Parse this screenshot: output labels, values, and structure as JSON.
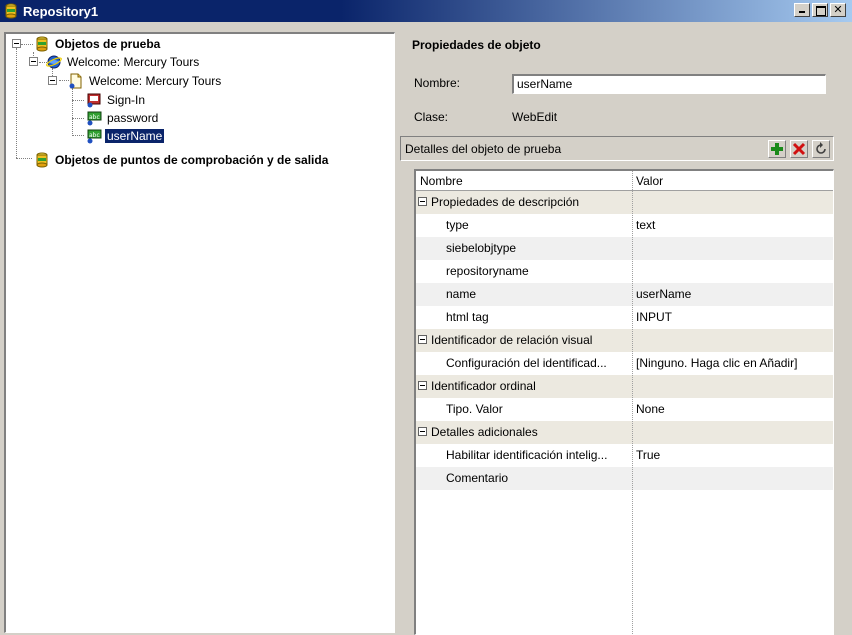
{
  "window": {
    "title": "Repository1",
    "title_bar_color": "#0a246a"
  },
  "tree": {
    "root_test_objects": "Objetos de prueba",
    "browser": "Welcome: Mercury Tours",
    "page": "Welcome: Mercury Tours",
    "items": [
      "Sign-In",
      "password",
      "userName"
    ],
    "selected_item": "userName",
    "root_checkpoints": "Objetos de puntos de comprobación y de salida"
  },
  "properties": {
    "section_title": "Propiedades de objeto",
    "name_label": "Nombre:",
    "name_value": "userName",
    "class_label": "Clase:",
    "class_value": "WebEdit",
    "details_title": "Detalles del objeto de prueba",
    "buttons": [
      "add-icon",
      "delete-icon",
      "refresh-icon"
    ]
  },
  "grid": {
    "columns": [
      "Nombre",
      "Valor"
    ],
    "rows": [
      {
        "type": "group",
        "name": "Propiedades de descripción",
        "value": ""
      },
      {
        "type": "item",
        "name": "type",
        "value": "text"
      },
      {
        "type": "item",
        "name": "siebelobjtype",
        "value": ""
      },
      {
        "type": "item",
        "name": "repositoryname",
        "value": ""
      },
      {
        "type": "item",
        "name": "name",
        "value": "userName"
      },
      {
        "type": "item",
        "name": "html tag",
        "value": "INPUT"
      },
      {
        "type": "group",
        "name": "Identificador de relación visual",
        "value": ""
      },
      {
        "type": "item",
        "name": "Configuración del identificad...",
        "value": "[Ninguno. Haga clic en Añadir]"
      },
      {
        "type": "group",
        "name": "Identificador ordinal",
        "value": ""
      },
      {
        "type": "item",
        "name": "Tipo. Valor",
        "value": "None"
      },
      {
        "type": "group",
        "name": "Detalles adicionales",
        "value": ""
      },
      {
        "type": "item",
        "name": "Habilitar identificación intelig...",
        "value": "True"
      },
      {
        "type": "item",
        "name": "Comentario",
        "value": ""
      }
    ]
  }
}
